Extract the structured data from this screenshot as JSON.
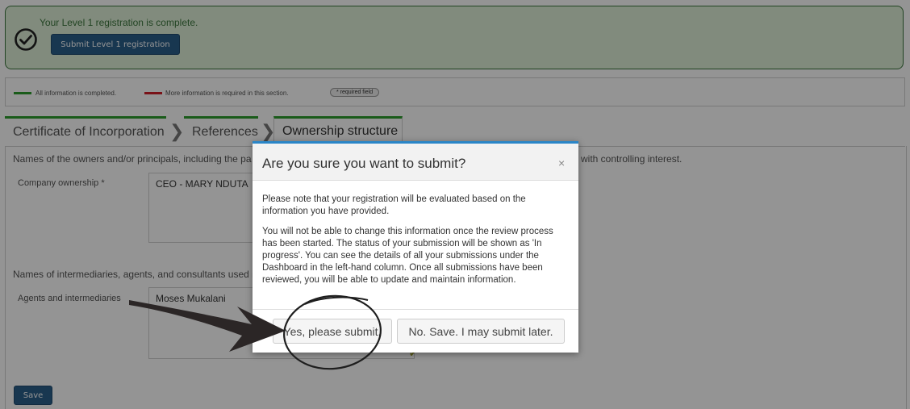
{
  "banner": {
    "message": "Your Level 1 registration is complete.",
    "submit_label": "Submit Level 1 registration"
  },
  "legend": {
    "complete_text": "All information is completed.",
    "incomplete_text": "More information is required in this section.",
    "required_text": "* required field",
    "complete_color": "#2e9e2e",
    "incomplete_color": "#d0202a"
  },
  "tabs": [
    {
      "label": "Certificate of Incorporation"
    },
    {
      "label": "References"
    },
    {
      "label": "Ownership structure"
    }
  ],
  "form": {
    "owners_intro": "Names of the owners and/or principals, including the pa",
    "owners_intro_tail": "with controlling interest.",
    "company_ownership_label": "Company ownership *",
    "company_ownership_value": "CEO - MARY NDUTA",
    "intermediaries_intro": "Names of intermediaries, agents, and consultants used i",
    "agents_label": "Agents and intermediaries",
    "agents_value": "Moses Mukalani",
    "save_label": "Save"
  },
  "modal": {
    "title": "Are you sure you want to submit?",
    "close_glyph": "×",
    "para1": "Please note that your registration will be evaluated based on the information you have provided.",
    "para2": "You will not be able to change this information once the review process has been started. The status of your submission will be shown as 'In progress'. You can see the details of all your submissions under the Dashboard in the left-hand column. Once all submissions have been reviewed, you will be able to update and maintain information.",
    "yes_label": "Yes, please submit.",
    "no_label": "No. Save. I may submit later."
  },
  "colors": {
    "accent": "#2a5f8a",
    "success_bg": "#dff0d8",
    "modal_top_border": "#2a86c8"
  }
}
